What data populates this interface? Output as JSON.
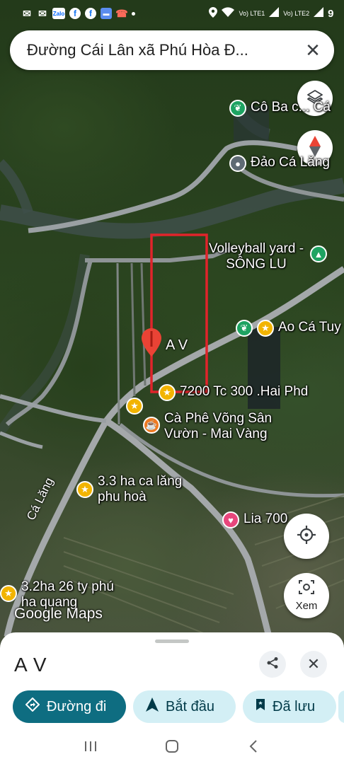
{
  "status_bar": {
    "clock": "9",
    "clock_icon": "clock-icon",
    "apps": [
      "Zalo",
      "f",
      "f"
    ],
    "network1": "Vo) LTE1",
    "network2": "Vo) LTE2"
  },
  "search": {
    "query": "Đường Cái Lân xã Phú Hòa Đ...",
    "close_icon": "close-icon"
  },
  "map": {
    "pois": [
      {
        "id": "co-ba",
        "text": "Cô Ba c... Cá",
        "pin": "green",
        "icon": "restaurant-icon"
      },
      {
        "id": "dao-ca-lang",
        "text": "Đảo Cá Lăng",
        "pin": "gray",
        "icon": "place-icon"
      },
      {
        "id": "volleyball",
        "text": "Volleyball yard - SÔNG LU",
        "pin": "green",
        "icon": "tree-icon"
      },
      {
        "id": "ao-ca",
        "text": "Ao Cá Tuy",
        "pin": "yellow",
        "icon": "star-icon"
      },
      {
        "id": "tc300",
        "text": "7200 Tc 300 .Hai Phd",
        "pin": "yellow",
        "icon": "star-icon"
      },
      {
        "id": "cafe",
        "text": "Cà Phê Võng Sân Vườn - Mai Vàng",
        "pin": "orange",
        "icon": "cafe-icon"
      },
      {
        "id": "ha33",
        "text": "3.3 ha ca lăng phu hoà",
        "pin": "yellow",
        "icon": "star-icon"
      },
      {
        "id": "lia",
        "text": "Lia 700",
        "pin": "pink",
        "icon": "heart-icon"
      },
      {
        "id": "ha32",
        "text": "3.2ha 26 ty phú ha quang",
        "pin": "yellow",
        "icon": "star-icon"
      }
    ],
    "road_label": "Cá Lăng",
    "marker_label": "A V",
    "logo": "Google Maps",
    "xem_label": "Xem"
  },
  "sheet": {
    "place_name": "A V",
    "directions_label": "Đường đi",
    "start_label": "Bắt đầu",
    "saved_label": "Đã lưu"
  },
  "colors": {
    "primary_chip": "#0e6d81",
    "light_chip": "#d3eff5",
    "highlight_box": "#e0242b",
    "marker": "#ea4335"
  }
}
